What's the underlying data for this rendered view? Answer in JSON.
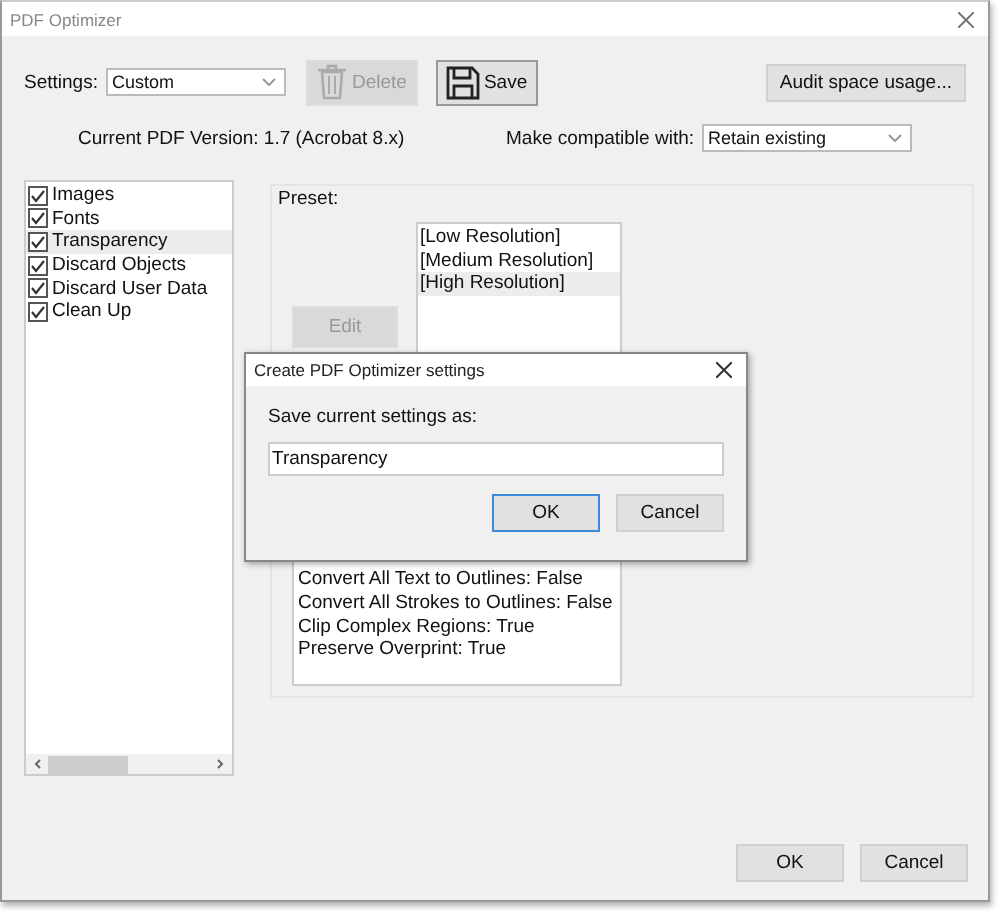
{
  "window": {
    "title": "PDF Optimizer"
  },
  "settings": {
    "label": "Settings:",
    "value": "Custom"
  },
  "toolbar": [
    {
      "label": "Delete",
      "kind": "delete",
      "disabled": true
    },
    {
      "label": "Save",
      "kind": "save",
      "disabled": false
    },
    {
      "label": "Audit space usage...",
      "kind": "plain",
      "disabled": false
    }
  ],
  "version_text": "Current PDF Version: 1.7 (Acrobat 8.x)",
  "compat": {
    "label": "Make compatible with:",
    "value": "Retain existing"
  },
  "categories": [
    {
      "label": "Images",
      "checked": true,
      "selected": false
    },
    {
      "label": "Fonts",
      "checked": true,
      "selected": false
    },
    {
      "label": "Transparency",
      "checked": true,
      "selected": true
    },
    {
      "label": "Discard Objects",
      "checked": true,
      "selected": false
    },
    {
      "label": "Discard User Data",
      "checked": true,
      "selected": false
    },
    {
      "label": "Clean Up",
      "checked": true,
      "selected": false
    }
  ],
  "preset": {
    "label": "Preset:",
    "edit_button": {
      "label": "Edit",
      "disabled": true
    },
    "items": [
      {
        "label": "[Low Resolution]",
        "selected": false
      },
      {
        "label": "[Medium Resolution]",
        "selected": false
      },
      {
        "label": "[High Resolution]",
        "selected": true
      }
    ],
    "summary": [
      "Convert All Text to Outlines: False",
      "Convert All Strokes to Outlines: False",
      "Clip Complex Regions: True",
      "Preserve Overprint: True"
    ]
  },
  "buttons": [
    "OK",
    "Cancel"
  ],
  "dialog": {
    "title": "Create PDF Optimizer settings",
    "label": "Save current settings as:",
    "value": "Transparency",
    "buttons": [
      {
        "label": "OK",
        "default": true
      },
      {
        "label": "Cancel",
        "default": false
      }
    ]
  }
}
